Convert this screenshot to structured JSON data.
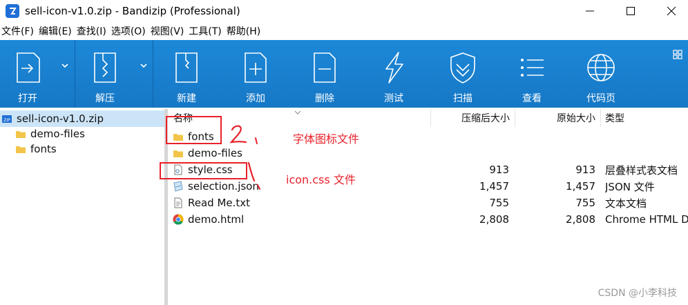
{
  "window": {
    "title": "sell-icon-v1.0.zip - Bandizip (Professional)",
    "app_icon": "bandizip-logo-icon",
    "controls": [
      "minimize-icon",
      "maximize-icon",
      "close-icon"
    ]
  },
  "menu": [
    "文件(F)",
    "编辑(E)",
    "查找(I)",
    "选项(O)",
    "视图(V)",
    "工具(T)",
    "帮助(H)"
  ],
  "toolbar": {
    "background": "#1a82d2",
    "buttons": [
      {
        "label": "打开",
        "icon": "open-icon"
      },
      {
        "label": "解压",
        "icon": "extract-icon"
      },
      {
        "label": "新建",
        "icon": "new-archive-icon"
      },
      {
        "label": "添加",
        "icon": "add-icon"
      },
      {
        "label": "删除",
        "icon": "delete-icon"
      },
      {
        "label": "测试",
        "icon": "test-icon"
      },
      {
        "label": "扫描",
        "icon": "scan-shield-icon"
      },
      {
        "label": "查看",
        "icon": "view-list-icon"
      },
      {
        "label": "代码页",
        "icon": "codepage-globe-icon"
      }
    ]
  },
  "tree": {
    "root": "sell-icon-v1.0.zip",
    "children": [
      "demo-files",
      "fonts"
    ]
  },
  "columns": {
    "name": "名称",
    "packed": "压缩后大小",
    "original": "原始大小",
    "type": "类型"
  },
  "files": [
    {
      "name": "fonts",
      "icon": "folder-icon",
      "packed": "",
      "original": "",
      "type": ""
    },
    {
      "name": "demo-files",
      "icon": "folder-icon",
      "packed": "",
      "original": "",
      "type": ""
    },
    {
      "name": "style.css",
      "icon": "css-file-icon",
      "packed": "913",
      "original": "913",
      "type": "层叠样式表文档"
    },
    {
      "name": "selection.json",
      "icon": "json-file-icon",
      "packed": "1,457",
      "original": "1,457",
      "type": "JSON 文件"
    },
    {
      "name": "Read Me.txt",
      "icon": "text-file-icon",
      "packed": "755",
      "original": "755",
      "type": "文本文档"
    },
    {
      "name": "demo.html",
      "icon": "chrome-icon",
      "packed": "2,808",
      "original": "2,808",
      "type": "Chrome HTML D"
    }
  ],
  "annotations": {
    "color": "#e8202a",
    "label_fonts": "字体图标文件",
    "label_css": "icon.css 文件",
    "mark_2": "2",
    "mark_1": "1"
  },
  "watermark": "CSDN @小李科技"
}
